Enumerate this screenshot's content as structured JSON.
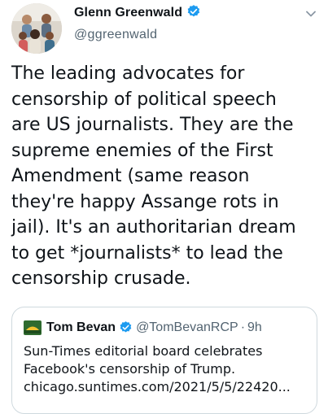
{
  "author": {
    "name": "Glenn Greenwald",
    "handle": "@ggreenwald",
    "verified_icon": "verified-badge-icon"
  },
  "tweet": {
    "text": "The leading advocates for\ncensorship of political speech\nare US journalists. They are the\nsupreme enemies of the First\nAmendment (same reason\nthey're happy Assange rots in\njail). It's an authoritarian dream\nto get *journalists* to lead the\ncensorship crusade."
  },
  "quoted_tweet": {
    "name": "Tom Bevan",
    "handle": "@TomBevanRCP",
    "separator": "·",
    "time": "9h",
    "text": "Sun-Times editorial board celebrates\nFacebook's censorship of Trump.\nchicago.suntimes.com/2021/5/5/22420..."
  },
  "colors": {
    "verified": "#1d9bf0",
    "secondary_text": "#536471",
    "border": "#cfd9de"
  }
}
